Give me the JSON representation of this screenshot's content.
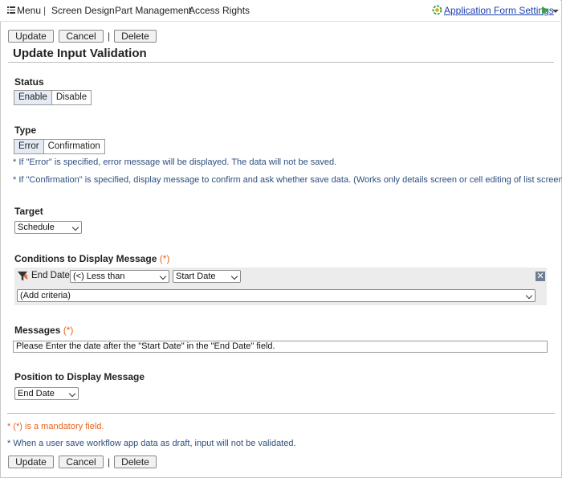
{
  "topbar": {
    "menu_label": "Menu",
    "sep": "|",
    "items": [
      "Screen Design",
      "Part Management",
      "Access Rights"
    ],
    "app_form_settings": "Application Form Settings"
  },
  "toolbar": {
    "update": "Update",
    "cancel": "Cancel",
    "pipe": "|",
    "delete": "Delete"
  },
  "page_title": "Update Input Validation",
  "status": {
    "label": "Status",
    "options": [
      "Enable",
      "Disable"
    ],
    "selected": "Enable"
  },
  "type": {
    "label": "Type",
    "options": [
      "Error",
      "Confirmation"
    ],
    "selected": "Error",
    "note_error": "* If \"Error\" is specified, error message will be displayed. The data will not be saved.",
    "note_confirm": "* If \"Confirmation\" is specified, display message to confirm and ask whether save data. (Works only details screen or cell editing of list screen)"
  },
  "target": {
    "label": "Target",
    "value": "Schedule"
  },
  "conditions": {
    "label": "Conditions to Display Message",
    "required_mark": "(*)",
    "field": "End Date",
    "operator": "(<) Less than",
    "compare": "Start Date",
    "add_criteria": "(Add criteria)",
    "remove": "✕"
  },
  "messages": {
    "label": "Messages",
    "required_mark": "(*)",
    "value": "Please Enter the date after the \"Start Date\" in the \"End Date\" field."
  },
  "position": {
    "label": "Position to Display Message",
    "value": "End Date"
  },
  "footer": {
    "mandatory_note": "* (*) is a mandatory field.",
    "draft_note": "* When a user save workflow app data as draft, input will not be validated."
  },
  "colors": {
    "link": "#1a3fae",
    "note": "#2e4f7e",
    "required": "#e8631c",
    "selected_segment": "#e4ebf4"
  }
}
